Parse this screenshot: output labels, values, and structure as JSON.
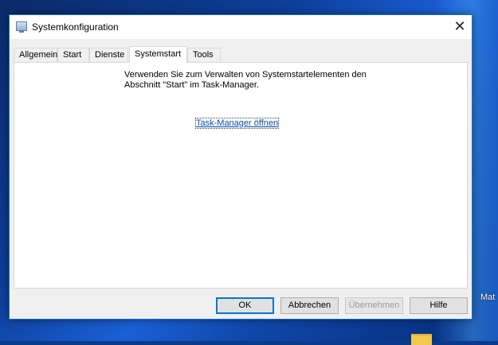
{
  "window": {
    "title": "Systemkonfiguration",
    "close_glyph": "✕"
  },
  "tabs": [
    {
      "label": "Allgemein",
      "active": false
    },
    {
      "label": "Start",
      "active": false
    },
    {
      "label": "Dienste",
      "active": false
    },
    {
      "label": "Systemstart",
      "active": true
    },
    {
      "label": "Tools",
      "active": false
    }
  ],
  "panel": {
    "text": "Verwenden Sie zum Verwalten von Systemstartelementen den Abschnitt \"Start\" im Task-Manager.",
    "link": "Task-Manager öffnen"
  },
  "buttons": {
    "ok": "OK",
    "cancel": "Abbrechen",
    "apply": "Übernehmen",
    "help": "Hilfe"
  },
  "desktop": {
    "label": "Mat"
  },
  "colors": {
    "accent": "#0078d7",
    "link": "#0a4ea8"
  }
}
